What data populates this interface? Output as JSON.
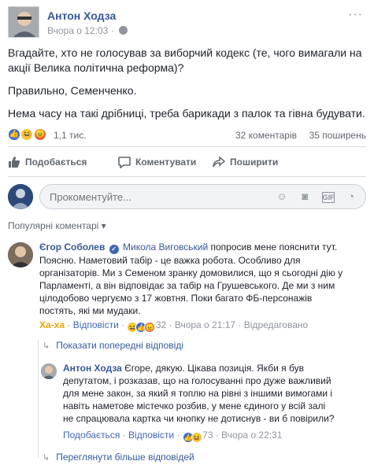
{
  "post": {
    "author": "Антон Ходза",
    "time": "Вчора о 12:03 · ",
    "more": "···",
    "paragraphs": [
      "Вгадайте, хто не голосував за виборчий кодекс (те, чого вимагали на акції Велика політична реформа)?",
      "Правильно, Семенченко.",
      "Нема часу на такі дрібниці, треба барикади з палок та гівна будувати."
    ],
    "reactions_count": "1,1 тис.",
    "comments_count": "32 коментарів",
    "shares_count": "35 поширень"
  },
  "actions": {
    "like": "Подобається",
    "comment": "Коментувати",
    "share": "Поширити"
  },
  "composer": {
    "placeholder": "Прокоментуйте..."
  },
  "popular_label": "Популярні коментарі ▾",
  "comments": [
    {
      "author": "Єгор Соболев",
      "mention": "Микола Виговський",
      "text_line1_rest": " попросив мене пояснити тут.",
      "lines": [
        "Поясню. Наметовий табір - це важка робота. Особливо для",
        "організаторів. Ми з Семеном зранку домовилися, що я сьогодні дію у",
        "Парламенті, а він відповідає за табір на Грушевського. Де ми з ним",
        "цілодобово чергуємо з 17 жовтня. Поки багато ФБ-персонажів",
        "постять, які ми мудаки."
      ],
      "reaction_label": "Ха-ха",
      "reply_label": "Відповісти",
      "reaction_count": "32",
      "time": "Вчора о 21:17",
      "edited": "Відредаговано"
    },
    {
      "author": "Антон Ходза",
      "lines_first_rest": " Єгоре, дякую. Цікава позиція. Якби я був",
      "lines": [
        "депутатом, і розказав, що на голосуванні про дуже важливий",
        "для мене закон, за який я топлю на рівні з іншими вимогами і",
        "навіть наметове містечко розбив, у мене єдиного у всій залі",
        "не спрацювала картка чи кнопку не дотиснув - ви б повірили?"
      ],
      "like_label": "Подобається",
      "reply_label": "Відповісти",
      "reaction_count": "73",
      "time": "Вчора о 22:31"
    }
  ],
  "show_previous": "Показати попередні відповіді",
  "see_more": "Переглянути більше відповідей",
  "colors": {
    "link": "#385898",
    "like_blue": "#4267b2",
    "haha_yellow": "#e8a700"
  }
}
